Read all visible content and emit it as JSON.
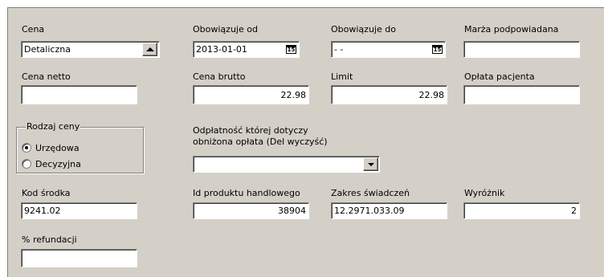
{
  "labels": {
    "cena": "Cena",
    "obowiazuje_od": "Obowiązuje od",
    "obowiazuje_do": "Obowiązuje do",
    "marza": "Marża podpowiadana",
    "cena_netto": "Cena netto",
    "cena_brutto": "Cena brutto",
    "limit": "Limit",
    "oplata_pacjenta": "Opłata pacjenta",
    "rodzaj_ceny": "Rodzaj ceny",
    "odplatnosc_line1": "Odpłatność której dotyczy",
    "odplatnosc_line2": "obniżona opłata (Del wyczyść)",
    "kod_srodka": "Kod środka",
    "id_produktu": "Id produktu handlowego",
    "zakres_swiadczen": "Zakres świadczeń",
    "wyroznik": "Wyróżnik",
    "refundacja": "% refundacji"
  },
  "values": {
    "cena": "Detaliczna",
    "obowiazuje_od": "2013-01-01",
    "obowiazuje_do": " - -",
    "marza": "",
    "cena_netto": "",
    "cena_brutto": "22.98",
    "limit": "22.98",
    "oplata_pacjenta": "",
    "odplatnosc": "",
    "kod_srodka": "9241.02",
    "id_produktu": "38904",
    "zakres_swiadczen": "12.2971.033.09",
    "wyroznik": "2",
    "refundacja": ""
  },
  "radio": {
    "options": [
      "Urzędowa",
      "Decyzyjna"
    ],
    "selected": "Urzędowa"
  },
  "icons": {
    "calendar_text": "15"
  }
}
